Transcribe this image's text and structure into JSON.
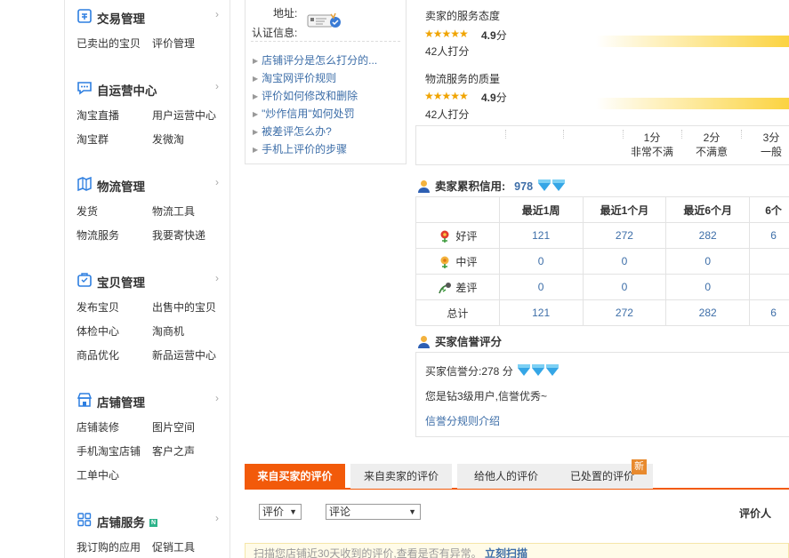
{
  "sidebar": {
    "sections": [
      {
        "title": "交易管理",
        "icon": "trade-icon",
        "links": [
          "已卖出的宝贝",
          "评价管理"
        ]
      },
      {
        "title": "自运营中心",
        "icon": "chat-icon",
        "links": [
          "淘宝直播",
          "用户运营中心",
          "淘宝群",
          "发微淘"
        ]
      },
      {
        "title": "物流管理",
        "icon": "logistics-icon",
        "links": [
          "发货",
          "物流工具",
          "物流服务",
          "我要寄快递"
        ]
      },
      {
        "title": "宝贝管理",
        "icon": "goods-icon",
        "links": [
          "发布宝贝",
          "出售中的宝贝",
          "体检中心",
          "淘商机",
          "商品优化",
          "新品运营中心"
        ]
      },
      {
        "title": "店铺管理",
        "icon": "shop-icon",
        "links": [
          "店铺装修",
          "图片空间",
          "手机淘宝店铺",
          "客户之声",
          "工单中心"
        ]
      },
      {
        "title": "店铺服务",
        "icon": "grid-icon",
        "badge": "N",
        "links": [
          "我订购的应用",
          "促销工具"
        ]
      }
    ],
    "arrow": "›"
  },
  "info": {
    "address_label": "地址:",
    "cert_label": "认证信息:",
    "help_links": [
      "店铺评分是怎么打分的...",
      "淘宝网评价规则",
      "评价如何修改和删除",
      "\"炒作信用\"如何处罚",
      "被差评怎么办?",
      "手机上评价的步骤"
    ]
  },
  "ratings": [
    {
      "label": "卖家的服务态度",
      "stars": "★★★★★",
      "score": "4.9",
      "unit": "分",
      "raters": "42人打分"
    },
    {
      "label": "物流服务的质量",
      "stars": "★★★★★",
      "score": "4.9",
      "unit": "分",
      "raters": "42人打分"
    }
  ],
  "scale": [
    {
      "score": "1分",
      "desc": "非常不满"
    },
    {
      "score": "2分",
      "desc": "不满意"
    },
    {
      "score": "3分",
      "desc": "一般"
    }
  ],
  "seller_credit": {
    "title": "卖家累积信用:",
    "value": "978",
    "columns": [
      "",
      "最近1周",
      "最近1个月",
      "最近6个月",
      "6个"
    ],
    "rows": [
      {
        "label": "好评",
        "icon": "good-flower-icon",
        "values": [
          "121",
          "272",
          "282",
          "6"
        ]
      },
      {
        "label": "中评",
        "icon": "neutral-flower-icon",
        "values": [
          "0",
          "0",
          "0",
          ""
        ]
      },
      {
        "label": "差评",
        "icon": "bad-flower-icon",
        "values": [
          "0",
          "0",
          "0",
          ""
        ]
      },
      {
        "label": "总计",
        "icon": "",
        "values": [
          "121",
          "272",
          "282",
          "6"
        ]
      }
    ]
  },
  "buyer_credit": {
    "title": "买家信誉评分",
    "score_text": "买家信誉分:278 分",
    "level_text": "您是钻3级用户,信誉优秀~",
    "rule_link": "信誉分规则介绍"
  },
  "tabs": [
    "来自买家的评价",
    "来自卖家的评价",
    "给他人的评价",
    "已处置的评价"
  ],
  "new_badge": "新",
  "filters": {
    "rating_select": "评价",
    "comment_select": "评论",
    "rater_header": "评价人"
  },
  "notice": {
    "text": "扫描您店铺近30天收到的评价,查看是否有异常。",
    "link": "立刻扫描"
  },
  "colors": {
    "accent": "#f25a0a",
    "link": "#3d6ea8",
    "star": "#f0a400"
  }
}
